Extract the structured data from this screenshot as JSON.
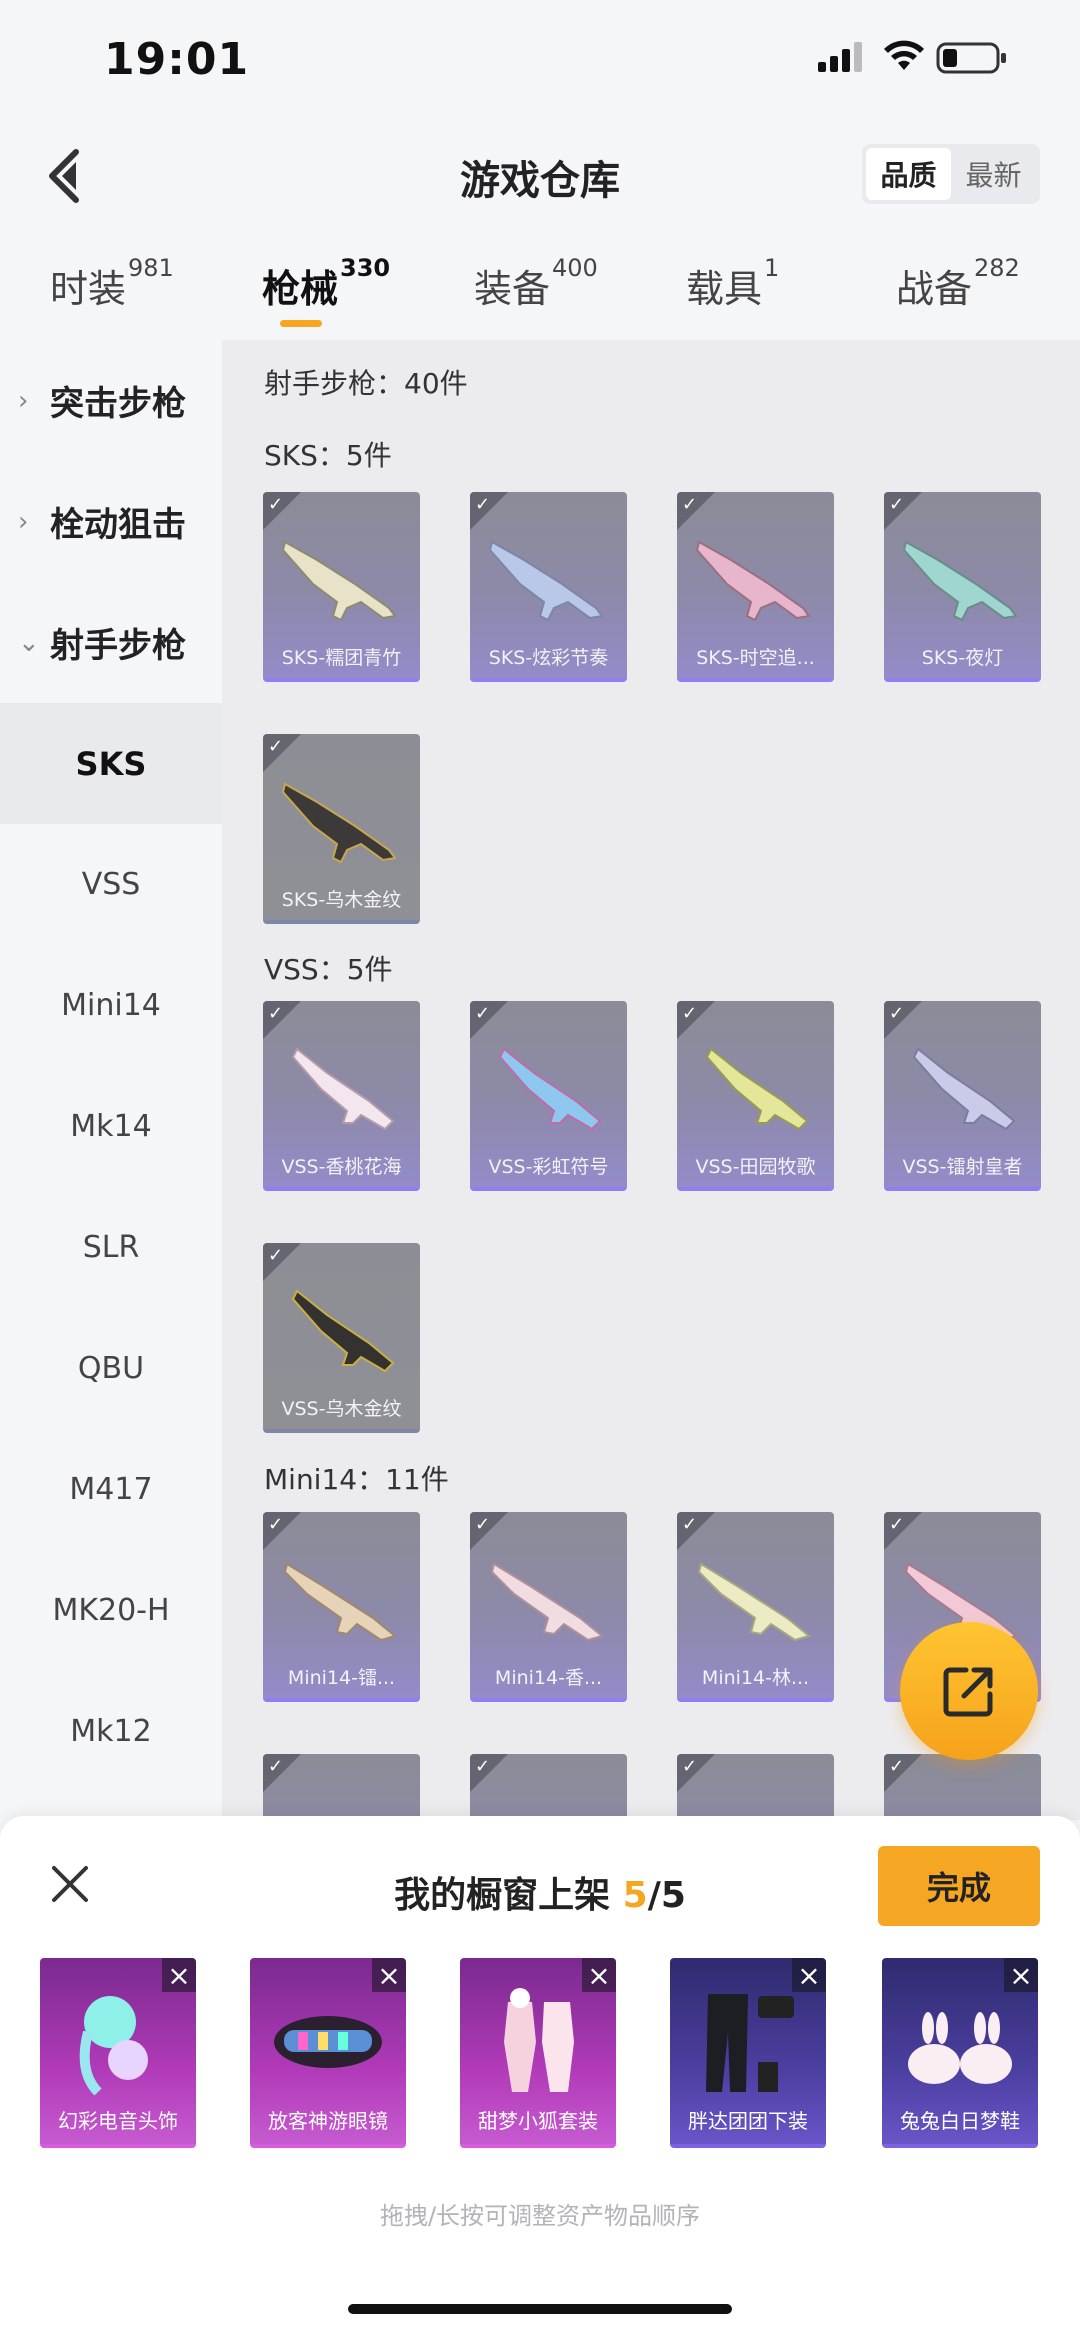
{
  "status": {
    "time": "19:01"
  },
  "header": {
    "title": "游戏仓库",
    "sort": [
      "品质",
      "最新"
    ]
  },
  "tabs": [
    {
      "label": "时装",
      "count": "981"
    },
    {
      "label": "枪械",
      "count": "330"
    },
    {
      "label": "装备",
      "count": "400"
    },
    {
      "label": "载具",
      "count": "1"
    },
    {
      "label": "战备",
      "count": "282"
    }
  ],
  "sidebar": {
    "groups": [
      "突击步枪",
      "栓动狙击",
      "射手步枪"
    ],
    "items": [
      "SKS",
      "VSS",
      "Mini14",
      "Mk14",
      "SLR",
      "QBU",
      "M417",
      "MK20-H",
      "Mk12"
    ]
  },
  "content": {
    "category_total": "射手步枪：40件",
    "sections": [
      {
        "head": "SKS：5件",
        "items": [
          "SKS-糯团青竹",
          "SKS-炫彩节奏",
          "SKS-时空追...",
          "SKS-夜灯",
          "SKS-乌木金纹"
        ]
      },
      {
        "head": "VSS：5件",
        "items": [
          "VSS-香桃花海",
          "VSS-彩虹符号",
          "VSS-田园牧歌",
          "VSS-镭射皇者",
          "VSS-乌木金纹"
        ]
      },
      {
        "head": "Mini14：11件",
        "items": [
          "Mini14-镭...",
          "Mini14-香...",
          "Mini14-林...",
          ""
        ]
      }
    ]
  },
  "panel": {
    "title_prefix": "我的橱窗上架 ",
    "count_current": "5",
    "count_total": "/5",
    "done": "完成",
    "items": [
      "幻彩电音头饰",
      "放客神游眼镜",
      "甜梦小狐套装",
      "胖达团团下装",
      "兔兔白日梦鞋"
    ],
    "hint": "拖拽/长按可调整资产物品顺序"
  },
  "colors": {
    "accent": "#f5a623",
    "card_purple": "#948bc9",
    "shelf_magenta": "#b13ab8"
  }
}
